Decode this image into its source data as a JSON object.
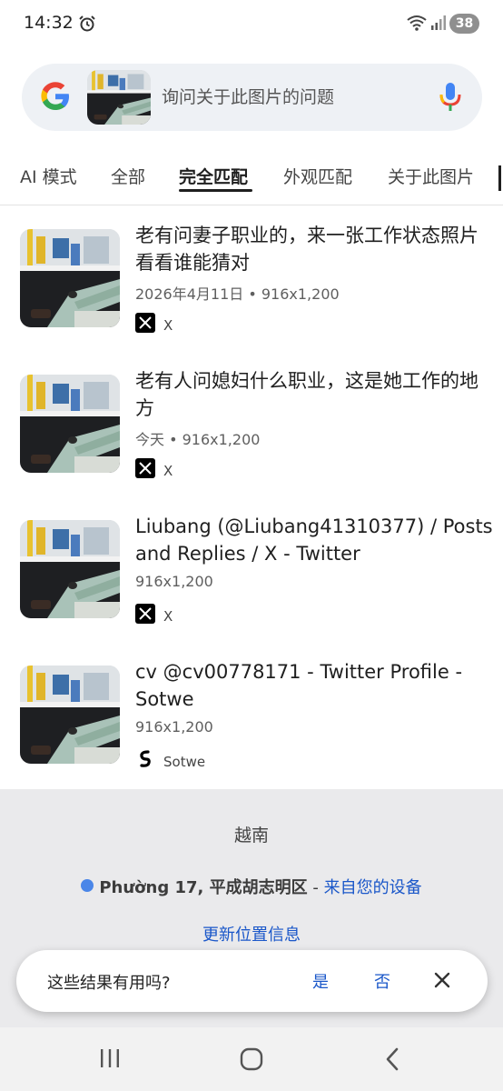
{
  "status_bar": {
    "time": "14:32",
    "battery": "38",
    "icons": [
      "alarm-icon",
      "wifi-icon",
      "signal-icon"
    ]
  },
  "search": {
    "placeholder": "询问关于此图片的问题",
    "icons": [
      "google-logo-icon",
      "mic-icon"
    ]
  },
  "tabs": [
    {
      "label": "AI 模式"
    },
    {
      "label": "全部"
    },
    {
      "label": "完全匹配",
      "active": true
    },
    {
      "label": "外观匹配"
    },
    {
      "label": "关于此图片"
    }
  ],
  "results": [
    {
      "title": "老有问妻子职业的，来一张工作状态照片看看谁能猜对",
      "meta": "2026年4月11日 • 916x1,200",
      "source": "X",
      "source_icon": "x-logo-icon"
    },
    {
      "title": "老有人问媳妇什么职业，这是她工作的地方",
      "meta": "今天 • 916x1,200",
      "source": "X",
      "source_icon": "x-logo-icon"
    },
    {
      "title": "Liubang (@Liubang41310377) / Posts and Replies / X - Twitter",
      "meta": "916x1,200",
      "source": "X",
      "source_icon": "x-logo-icon"
    },
    {
      "title": "cv @cv00778171 - Twitter Profile - Sotwe",
      "meta": "916x1,200",
      "source": "Sotwe",
      "source_icon": "sotwe-logo-icon"
    }
  ],
  "location": {
    "country": "越南",
    "place": "Phường 17, 平成胡志明区",
    "separator": " - ",
    "source": "来自您的设备",
    "update_link": "更新位置信息"
  },
  "feedback": {
    "question": "这些结果有用吗?",
    "yes": "是",
    "no": "否"
  },
  "colors": {
    "link": "#1a57c9",
    "location_dot": "#4a86e8",
    "panel": "#eaeaec"
  }
}
